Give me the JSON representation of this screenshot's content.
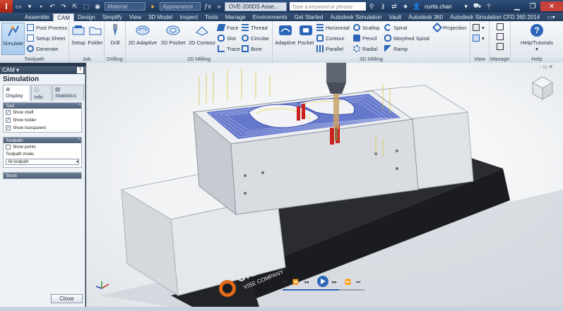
{
  "titlebar": {
    "app_letter": "I",
    "material_placeholder": "Material",
    "appearance_placeholder": "Appearance",
    "document_title": "OVE-200DS Asse...",
    "search_placeholder": "Type a keyword or phrase",
    "user": "curtis.chan"
  },
  "ribbon_tabs": [
    "Assemble",
    "CAM",
    "Design",
    "Simplify",
    "View",
    "3D Model",
    "Inspect",
    "Tools",
    "Manage",
    "Environments",
    "Get Started",
    "Autodesk Simulation",
    "Vault",
    "Autodesk 360",
    "Autodesk Simulation CFD 360 2014"
  ],
  "active_tab": "CAM",
  "ribbon": {
    "toolpath": {
      "label": "Toolpath",
      "simulate": "Simulate",
      "post_process": "Post Process",
      "setup_sheet": "Setup Sheet",
      "generate": "Generate"
    },
    "job": {
      "label": "Job",
      "setup": "Setup",
      "folder": "Folder"
    },
    "drilling": {
      "label": "Drilling",
      "drill": "Drill"
    },
    "milling2d": {
      "label": "2D Milling",
      "adaptive": "2D Adaptive",
      "pocket": "2D Pocket",
      "contour": "2D Contour",
      "face": "Face",
      "slot": "Slot",
      "trace": "Trace",
      "thread": "Thread",
      "circular": "Circular",
      "bore": "Bore"
    },
    "milling3d": {
      "label": "3D Milling",
      "adaptive": "Adaptive",
      "pocket": "Pocket",
      "horizontal": "Horizontal",
      "contour": "Contour",
      "parallel": "Parallel",
      "scallop": "Scallop",
      "pencil": "Pencil",
      "radial": "Radial",
      "spiral": "Spiral",
      "morphed_spiral": "Morphed Spiral",
      "ramp": "Ramp",
      "projection": "Projection"
    },
    "view": {
      "label": "View"
    },
    "manage": {
      "label": "Manage"
    },
    "help": {
      "label": "Help",
      "help_tutorials": "Help/Tutorials"
    }
  },
  "browser": {
    "header": "CAM",
    "title": "Simulation",
    "tabs": [
      "Display",
      "Info",
      "Statistics"
    ],
    "tool_section": "Tool",
    "tool_options": [
      "Show shaft",
      "Show holder",
      "Show transparent"
    ],
    "toolpath_section": "Toolpath",
    "show_points": "Show points",
    "toolpath_mode_label": "Toolpath mode:",
    "toolpath_mode_value": "All toolpath",
    "stock_section": "Stock",
    "close": "Close"
  },
  "viewport": {
    "vise_brand_line1": "ORANGE",
    "vise_brand_line2": "VISE COMPANY"
  },
  "colors": {
    "accent": "#f0a23a",
    "ribbon_blue": "#2c66b8",
    "stock_blue": "#4e63c4"
  }
}
